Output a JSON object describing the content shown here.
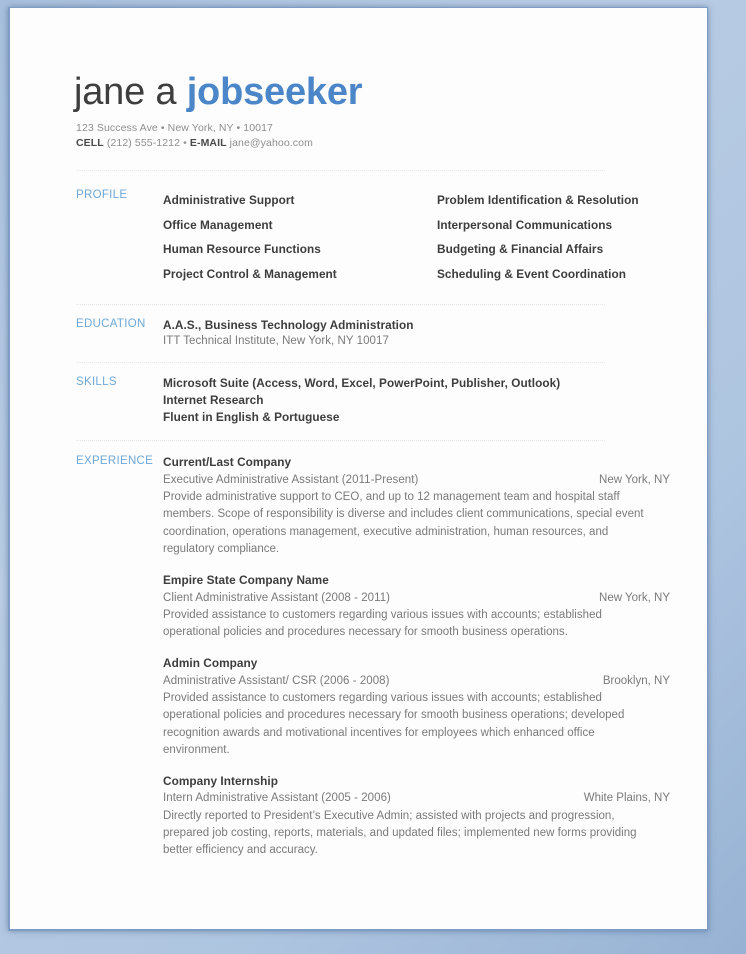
{
  "header": {
    "name_first": "jane a ",
    "name_last": "jobseeker",
    "address": "123 Success Ave • New York, NY • 10017",
    "cell_label": "CELL",
    "cell_value": " (212) 555-1212 ",
    "bullet": "• ",
    "email_label": "E-MAIL",
    "email_value": " jane@yahoo.com"
  },
  "sections": {
    "profile": {
      "label": "PROFILE",
      "items_left": [
        "Administrative Support",
        "Office Management",
        "Human Resource Functions",
        "Project Control & Management"
      ],
      "items_right": [
        "Problem Identification & Resolution",
        "Interpersonal Communications",
        "Budgeting & Financial Affairs",
        "Scheduling & Event Coordination"
      ]
    },
    "education": {
      "label": "EDUCATION",
      "degree": "A.A.S., Business Technology Administration",
      "institution": "ITT Technical Institute, New York, NY 10017"
    },
    "skills": {
      "label": "SKILLS",
      "items": [
        "Microsoft Suite (Access, Word, Excel, PowerPoint, Publisher, Outlook)",
        "Internet Research",
        "Fluent in English & Portuguese"
      ]
    },
    "experience": {
      "label": "EXPERIENCE",
      "jobs": [
        {
          "company": "Current/Last Company",
          "title": "Executive Administrative Assistant (2011-Present)",
          "location": "New York, NY",
          "description": "Provide administrative support to CEO, and up to 12 management team and hospital staff members. Scope of responsibility is diverse and includes client communications, special event coordination, operations management, executive administration, human resources, and regulatory compliance."
        },
        {
          "company": "Empire State Company Name",
          "title": "Client Administrative Assistant (2008 - 2011)",
          "location": "New York, NY",
          "description": "Provided assistance to customers regarding various issues with accounts; established operational policies and procedures necessary for smooth business operations."
        },
        {
          "company": "Admin Company",
          "title": "Administrative Assistant/ CSR (2006 - 2008)",
          "location": "Brooklyn, NY",
          "description": "Provided assistance to customers regarding various issues with accounts; established operational policies and procedures necessary for smooth business operations; developed recognition awards and motivational incentives for employees which enhanced office environment."
        },
        {
          "company": "Company Internship",
          "title": "Intern Administrative Assistant (2005 - 2006)",
          "location": "White Plains, NY",
          "description": "Directly reported to President’s Executive Admin; assisted with projects and progression, prepared job costing, reports, materials, and updated files; implemented new forms providing better efficiency and accuracy."
        }
      ]
    }
  }
}
